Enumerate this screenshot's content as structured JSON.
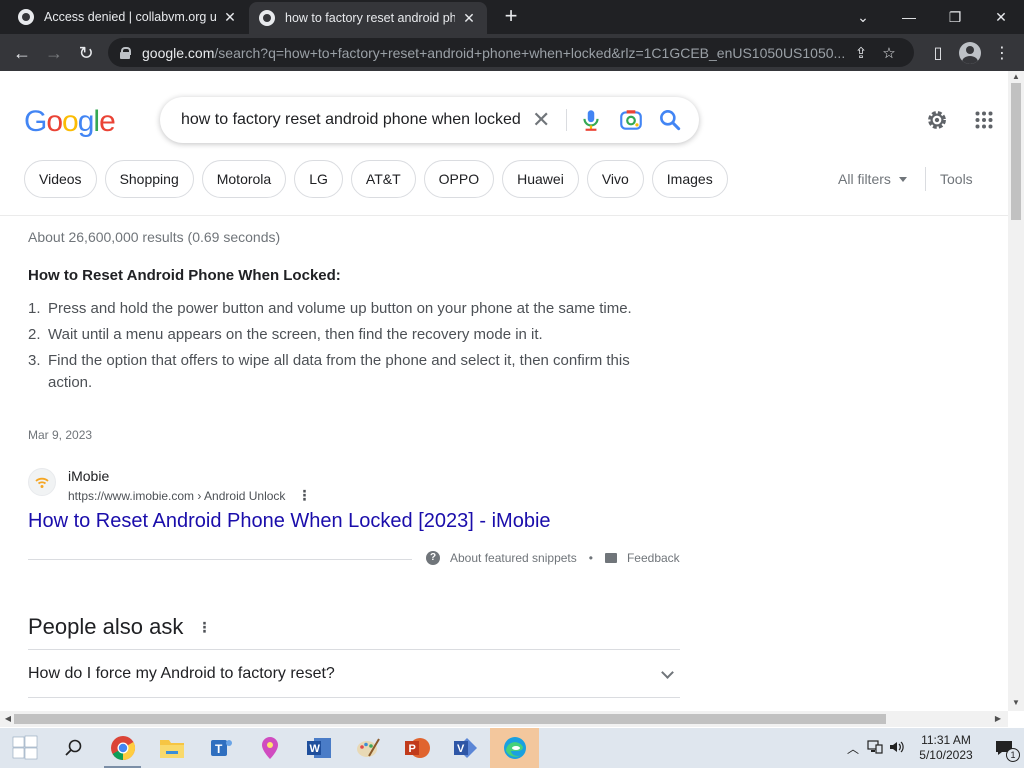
{
  "browser": {
    "tabs": [
      {
        "title": "Access denied | collabvm.org use",
        "active": false
      },
      {
        "title": "how to factory reset android pho",
        "active": true
      }
    ],
    "url_host": "google.com",
    "url_path": "/search?q=how+to+factory+reset+android+phone+when+locked&rlz=1C1GCEB_enUS1050US1050..."
  },
  "search": {
    "logo_letters": [
      "G",
      "o",
      "o",
      "g",
      "l",
      "e"
    ],
    "logo_colors": [
      "#4285F4",
      "#EA4335",
      "#FBBC05",
      "#4285F4",
      "#34A853",
      "#EA4335"
    ],
    "query": "how to factory reset android phone when locked",
    "chips": [
      "Videos",
      "Shopping",
      "Motorola",
      "LG",
      "AT&T",
      "OPPO",
      "Huawei",
      "Vivo",
      "Images"
    ],
    "all_filters": "All filters",
    "tools": "Tools"
  },
  "results": {
    "stats": "About 26,600,000 results (0.69 seconds)",
    "snippet": {
      "heading": "How to Reset Android Phone When Locked:",
      "steps": [
        {
          "num": "1.",
          "text": "Press and hold the power button and volume up button on your phone at the same time."
        },
        {
          "num": "2.",
          "text": "Wait until a menu appears on the screen, then find the recovery mode in it."
        },
        {
          "num": "3.",
          "text": "Find the option that offers to wipe all data from the phone and select it, then confirm this action."
        }
      ],
      "date": "Mar 9, 2023",
      "source_name": "iMobie",
      "source_url": "https://www.imobie.com › Android Unlock",
      "title": "How to Reset Android Phone When Locked [2023] - iMobie",
      "about_label": "About featured snippets",
      "separator": "•",
      "feedback_label": "Feedback"
    },
    "paa": {
      "title": "People also ask",
      "questions": [
        "How do I force my Android to factory reset?"
      ]
    }
  },
  "taskbar": {
    "time": "11:31 AM",
    "date": "5/10/2023",
    "notifications": "1"
  }
}
